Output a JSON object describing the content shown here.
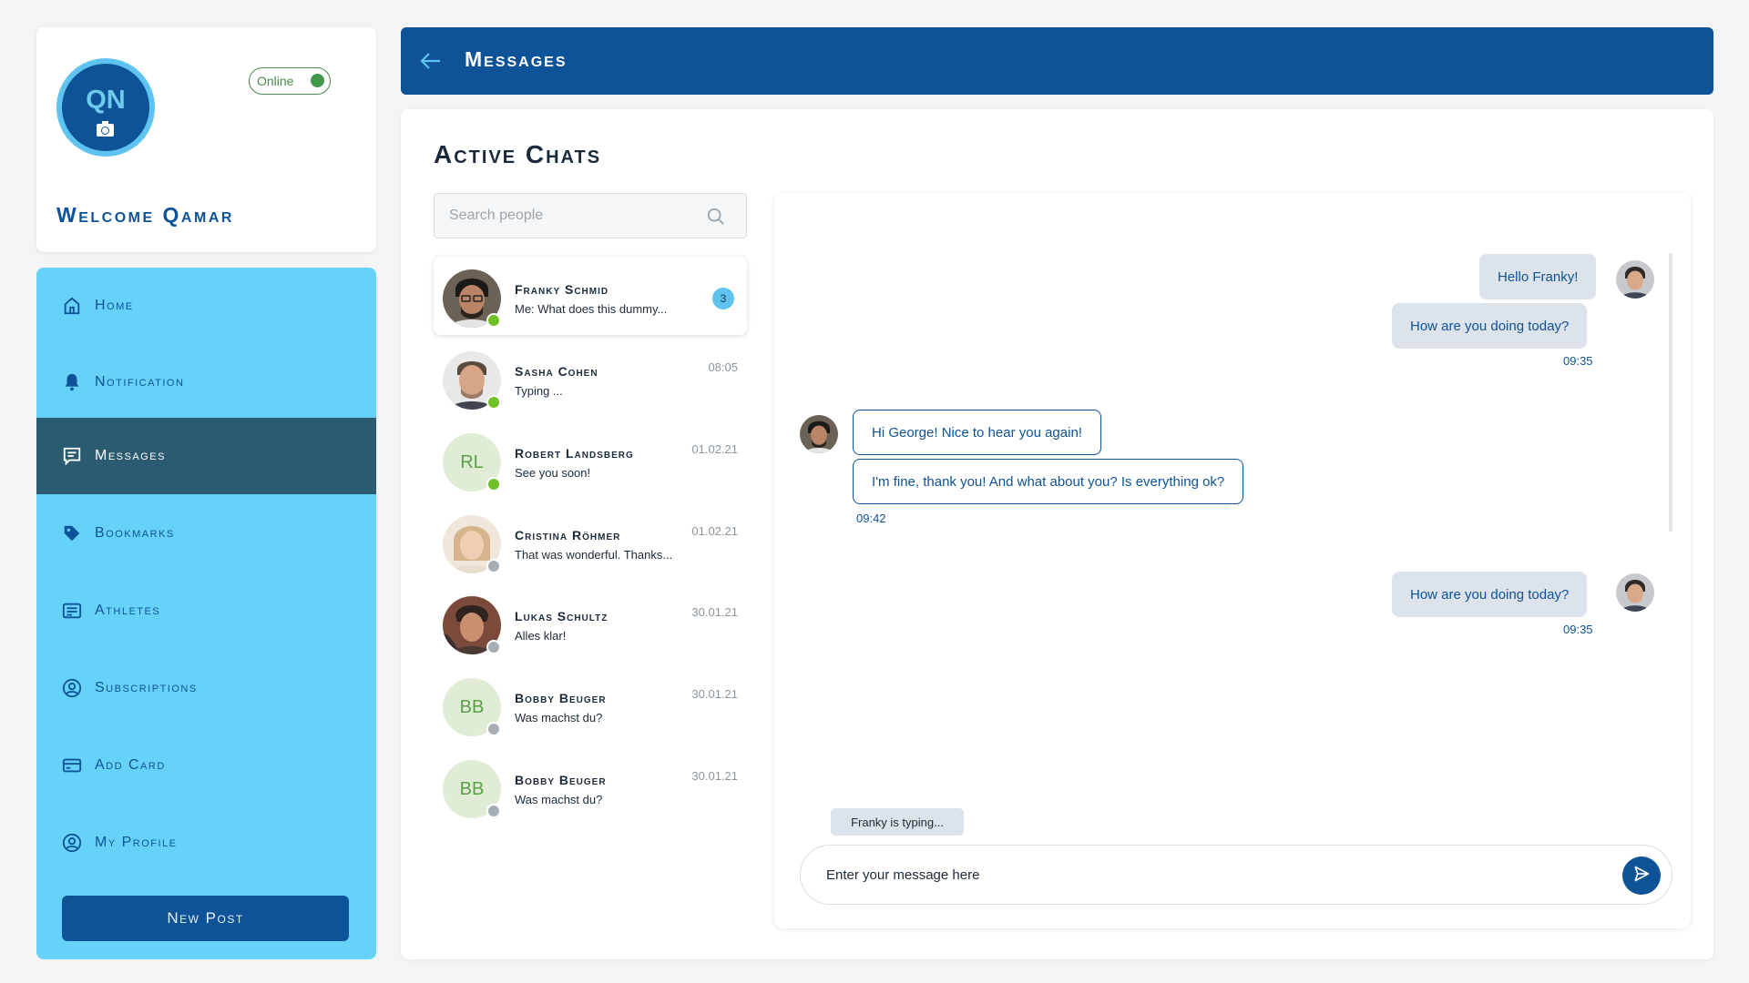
{
  "profile": {
    "initials": "QN",
    "status_label": "Online",
    "welcome": "Welcome Qamar"
  },
  "sidebar": {
    "items": [
      {
        "label": "Home",
        "icon": "home-icon"
      },
      {
        "label": "Notification",
        "icon": "bell-icon"
      },
      {
        "label": "Messages",
        "icon": "message-icon",
        "active": true
      },
      {
        "label": "Bookmarks",
        "icon": "tag-icon"
      },
      {
        "label": "Athletes",
        "icon": "list-card-icon"
      },
      {
        "label": "Subscriptions",
        "icon": "user-circle-icon"
      },
      {
        "label": "Add Card",
        "icon": "credit-card-icon"
      },
      {
        "label": "My Profile",
        "icon": "user-circle-icon"
      }
    ],
    "new_post_label": "New Post"
  },
  "header": {
    "title": "Messages",
    "back_icon": "arrow-left-icon"
  },
  "chats": {
    "title": "Active Chats",
    "search_placeholder": "Search people",
    "list": [
      {
        "name": "Franky Schmid",
        "preview": "Me: What does this dummy...",
        "time": "",
        "badge": "3",
        "online": true,
        "avatar": "photo"
      },
      {
        "name": "Sasha Cohen",
        "preview": "Typing ...",
        "time": "08:05",
        "badge": "",
        "online": true,
        "avatar": "photo"
      },
      {
        "name": "Robert Landsberg",
        "preview": "See you soon!",
        "time": "01.02.21",
        "badge": "",
        "online": true,
        "avatar": "RL"
      },
      {
        "name": "Cristina Röhmer",
        "preview": "That was wonderful. Thanks...",
        "time": "01.02.21",
        "badge": "",
        "online": false,
        "avatar": "photo"
      },
      {
        "name": "Lukas Schultz",
        "preview": "Alles klar!",
        "time": "30.01.21",
        "badge": "",
        "online": false,
        "avatar": "photo"
      },
      {
        "name": "Bobby Beuger",
        "preview": "Was machst du?",
        "time": "30.01.21",
        "badge": "",
        "online": false,
        "avatar": "BB"
      },
      {
        "name": "Bobby Beuger",
        "preview": "Was machst du?",
        "time": "30.01.21",
        "badge": "",
        "online": false,
        "avatar": "BB"
      }
    ]
  },
  "conversation": {
    "groups": [
      {
        "direction": "out",
        "messages": [
          "Hello Franky!",
          "How are you doing today?"
        ],
        "time": "09:35"
      },
      {
        "direction": "in",
        "messages": [
          "Hi George! Nice to hear you again!",
          "I'm fine, thank you! And what about you? Is everything ok?"
        ],
        "time": "09:42"
      },
      {
        "direction": "out",
        "messages": [
          "How are you doing today?"
        ],
        "time": "09:35"
      }
    ],
    "typing": "Franky is typing...",
    "input_placeholder": "Enter your message here",
    "send_icon": "send-icon"
  },
  "colors": {
    "primary": "#0e5297",
    "sidebar": "#66d2f9",
    "sidebar_active": "#2b5b71",
    "online": "#6fc025",
    "offline": "#a6adb3",
    "bubble_out": "#dde3ea"
  }
}
